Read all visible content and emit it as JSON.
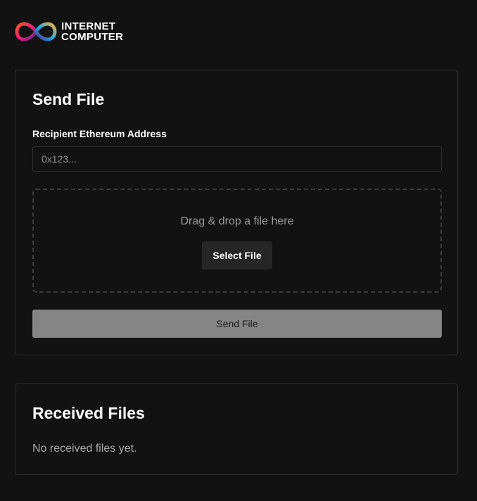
{
  "header": {
    "logo_line1": "INTERNET",
    "logo_line2": "COMPUTER"
  },
  "send_card": {
    "title": "Send File",
    "address_label": "Recipient Ethereum Address",
    "address_value": "",
    "address_placeholder": "0x123...",
    "dropzone_text": "Drag & drop a file here",
    "select_button": "Select File",
    "send_button": "Send File"
  },
  "received_card": {
    "title": "Received Files",
    "empty_message": "No received files yet."
  },
  "colors": {
    "background": "#121212",
    "card_border": "#2c2c2c",
    "send_button_bg": "#858585",
    "select_button_bg": "#262626",
    "logo_gradient": [
      "#29abe2",
      "#522785",
      "#ed1e79",
      "#f15a24",
      "#fbb03b"
    ]
  }
}
